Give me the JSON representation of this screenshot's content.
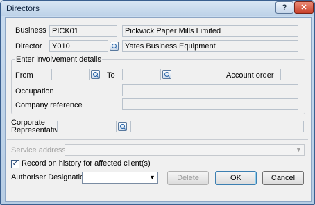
{
  "window": {
    "title": "Directors",
    "help_glyph": "?",
    "close_glyph": "✕"
  },
  "business": {
    "label": "Business",
    "code": "PICK01",
    "name": "Pickwick Paper Mills Limited"
  },
  "director": {
    "label": "Director",
    "code": "Y010",
    "name": "Yates Business Equipment"
  },
  "involvement": {
    "legend": "Enter involvement details",
    "from_label": "From",
    "from_value": "",
    "to_label": "To",
    "to_value": "",
    "account_order_label": "Account order",
    "account_order_value": "",
    "occupation_label": "Occupation",
    "occupation_value": "",
    "company_reference_label": "Company reference",
    "company_reference_value": ""
  },
  "corporate": {
    "label_line1": "Corporate",
    "label_line2": "Representative",
    "code": "",
    "name": ""
  },
  "service_address": {
    "label": "Service address",
    "value": ""
  },
  "record_history": {
    "label": "Record on history for affected client(s)",
    "checked": true,
    "check_glyph": "✓"
  },
  "authoriser": {
    "label": "Authoriser Designation",
    "value": "",
    "arrow": "▼"
  },
  "buttons": {
    "delete": "Delete",
    "ok": "OK",
    "cancel": "Cancel"
  }
}
